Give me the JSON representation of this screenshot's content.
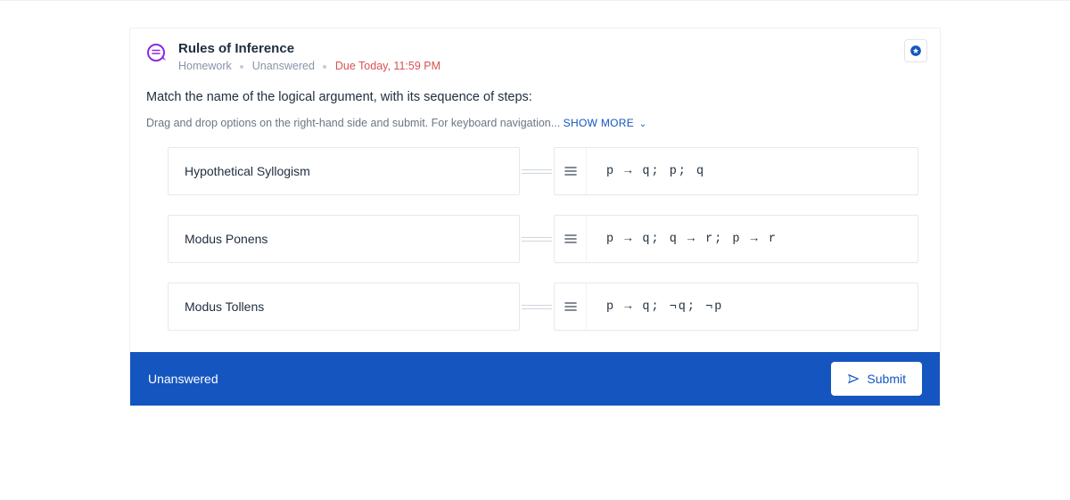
{
  "header": {
    "title": "Rules of Inference",
    "category": "Homework",
    "status": "Unanswered",
    "due": "Due Today, 11:59 PM"
  },
  "prompt": "Match the name of the logical argument, with its sequence of steps:",
  "instructions": "Drag and drop options on the right-hand side and submit. For keyboard navigation...",
  "show_more_label": "SHOW MORE",
  "pairs": [
    {
      "left": "Hypothetical Syllogism",
      "right": "p → q; p; q"
    },
    {
      "left": "Modus Ponens",
      "right": "p → q; q → r; p → r"
    },
    {
      "left": "Modus Tollens",
      "right": "p → q; ¬q; ¬p"
    }
  ],
  "footer": {
    "status": "Unanswered",
    "submit_label": "Submit"
  }
}
